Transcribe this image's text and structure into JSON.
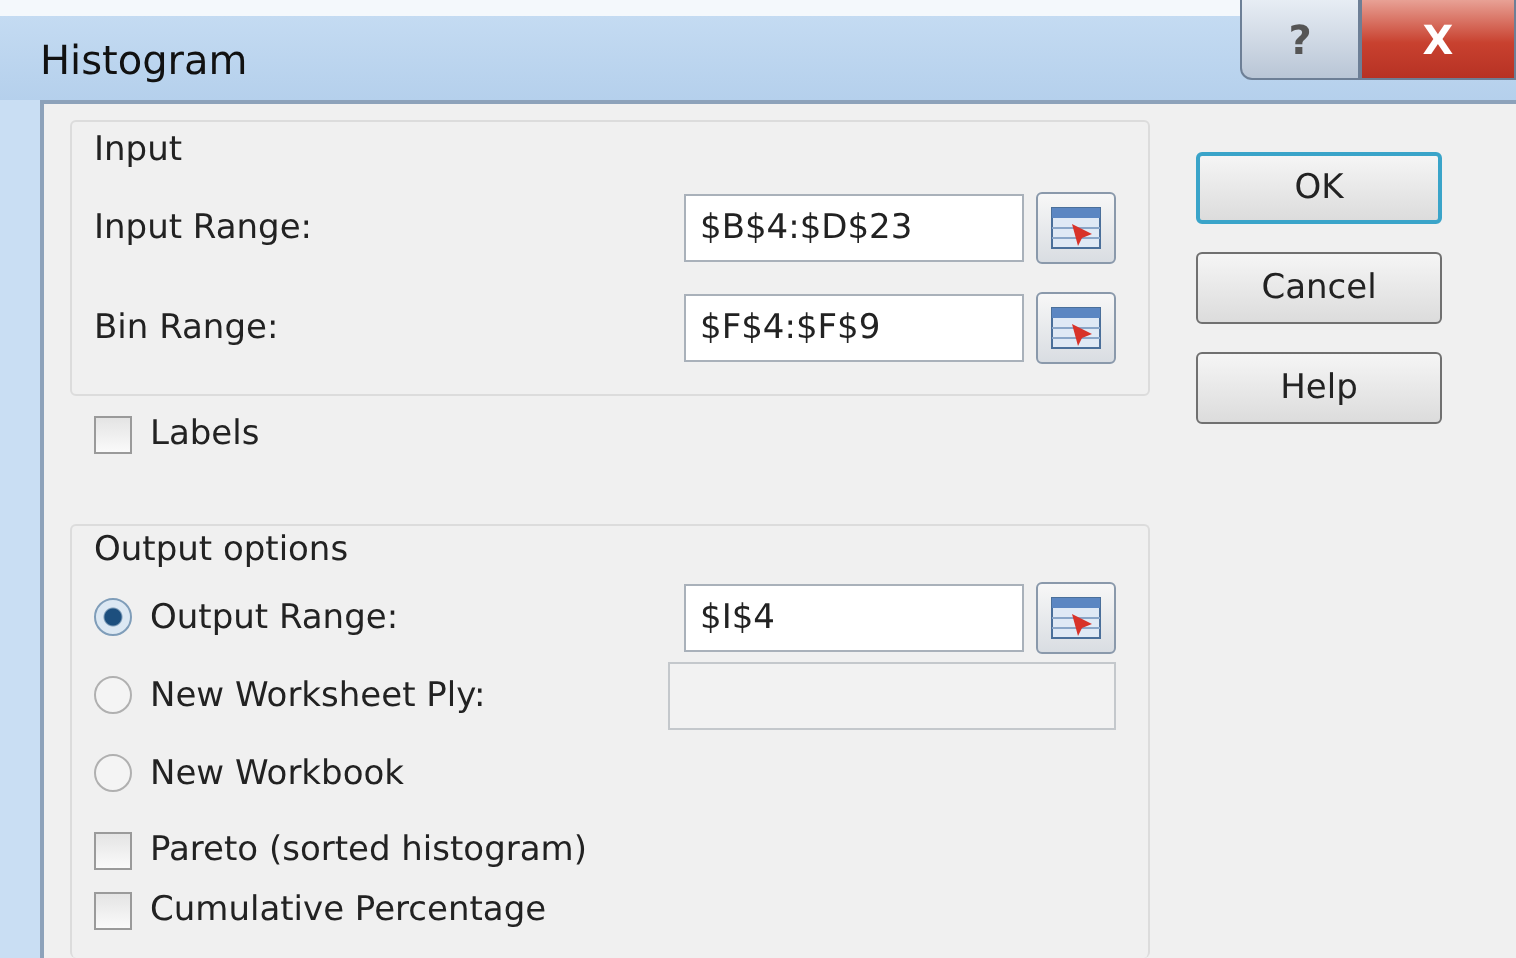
{
  "window": {
    "title": "Histogram",
    "help_glyph": "?",
    "close_glyph": "X"
  },
  "input_group": {
    "title": "Input",
    "fields": [
      {
        "label": "Input Range:",
        "value": "$B$4:$D$23"
      },
      {
        "label": "Bin Range:",
        "value": "$F$4:$F$9"
      }
    ]
  },
  "labels_checkbox": {
    "label": "Labels",
    "checked": false
  },
  "output_group": {
    "title": "Output options",
    "options": [
      {
        "label": "Output Range:",
        "selected": true,
        "value": "$I$4",
        "disabled": false
      },
      {
        "label": "New Worksheet Ply:",
        "selected": false,
        "disabled": true
      },
      {
        "label": "New Workbook",
        "selected": false
      }
    ],
    "checkboxes": [
      {
        "label": "Pareto (sorted histogram)",
        "checked": false
      },
      {
        "label": "Cumulative Percentage",
        "checked": false
      }
    ]
  },
  "buttons": [
    {
      "label": "OK",
      "default": true
    },
    {
      "label": "Cancel",
      "default": false
    },
    {
      "label": "Help",
      "default": false
    }
  ]
}
